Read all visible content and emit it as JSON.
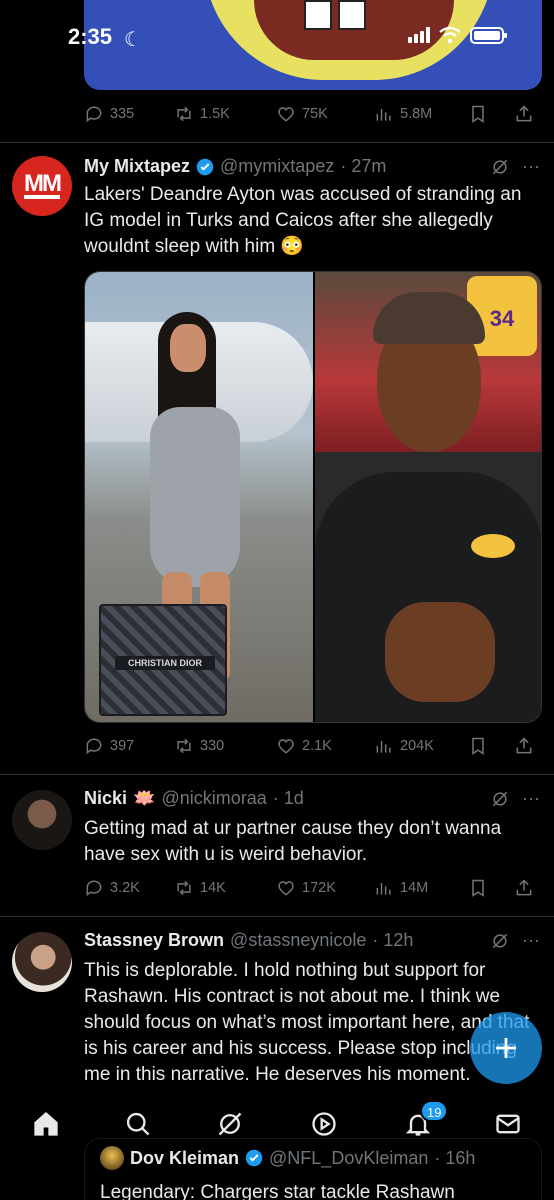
{
  "status_bar": {
    "time": "2:35"
  },
  "top_tweet": {
    "actions": {
      "replies": "335",
      "reposts": "1.5K",
      "likes": "75K",
      "views": "5.8M"
    }
  },
  "tweet_mixtapez": {
    "name": "My Mixtapez",
    "handle": "@mymixtapez",
    "time": "· 27m",
    "text": "Lakers' Deandre Ayton was accused of stranding an IG model in Turks and Caicos after she allegedly wouldnt sleep with him 😳",
    "avatar_text": "MM",
    "media_bag_label": "CHRISTIAN DIOR",
    "media_jersey_text": "34",
    "actions": {
      "replies": "397",
      "reposts": "330",
      "likes": "2.1K",
      "views": "204K"
    }
  },
  "tweet_nicki": {
    "name": "Nicki",
    "emoji": "🪷",
    "handle": "@nickimoraa",
    "time": "· 1d",
    "text": "Getting mad at ur partner cause they don’t wanna have sex with u is weird behavior.",
    "actions": {
      "replies": "3.2K",
      "reposts": "14K",
      "likes": "172K",
      "views": "14M"
    }
  },
  "tweet_stassney": {
    "name": "Stassney Brown",
    "handle": "@stassneynicole",
    "time": "· 12h",
    "text": "This is deplorable. I hold nothing but support for Rashawn. His contract is not about me. I think we should focus on what’s most important here, and that is his career and his success. Please stop including me in this narrative.  He deserves his moment.",
    "quote": {
      "name": "Dov Kleiman",
      "handle": "@NFL_DovKleiman",
      "time": "· 16h",
      "text": "Legendary: Chargers star tackle Rashawn"
    }
  },
  "bottom_nav": {
    "notifications_badge": "19",
    "items": [
      "home-icon",
      "search-icon",
      "grok-icon",
      "video-icon",
      "bell-icon",
      "mail-icon"
    ]
  },
  "colors": {
    "accent": "#1d9bf0",
    "muted": "#71767b",
    "text": "#e7e9ea",
    "divider": "#2f3336"
  }
}
